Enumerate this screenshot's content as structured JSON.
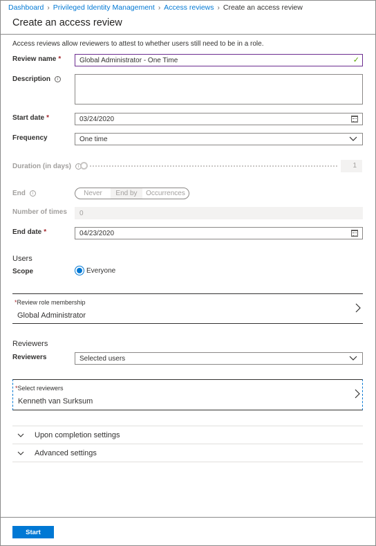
{
  "breadcrumb": {
    "items": [
      "Dashboard",
      "Privileged Identity Management",
      "Access reviews"
    ],
    "current": "Create an access review"
  },
  "page_title": "Create an access review",
  "intro": "Access reviews allow reviewers to attest to whether users still need to be in a role.",
  "form": {
    "review_name": {
      "label": "Review name",
      "value": "Global Administrator - One Time"
    },
    "description": {
      "label": "Description",
      "value": ""
    },
    "start_date": {
      "label": "Start date",
      "value": "03/24/2020"
    },
    "frequency": {
      "label": "Frequency",
      "value": "One time"
    },
    "duration": {
      "label": "Duration (in days)",
      "value": "1"
    },
    "end": {
      "label": "End",
      "options": [
        "Never",
        "End by",
        "Occurrences"
      ],
      "selected": "End by"
    },
    "number_of_times": {
      "label": "Number of times",
      "value": "0"
    },
    "end_date": {
      "label": "End date",
      "value": "04/23/2020"
    }
  },
  "users": {
    "heading": "Users",
    "scope_label": "Scope",
    "scope_value": "Everyone",
    "role_membership": {
      "label": "Review role membership",
      "value": "Global Administrator"
    }
  },
  "reviewers": {
    "heading": "Reviewers",
    "label": "Reviewers",
    "value": "Selected users",
    "select": {
      "label": "Select reviewers",
      "value": "Kenneth van Surksum"
    }
  },
  "expanders": [
    "Upon completion settings",
    "Advanced settings"
  ],
  "start_button": "Start",
  "required_mark": "*",
  "info_glyph": "i",
  "colors": {
    "accent": "#0078d4",
    "required": "#a4262c",
    "valid": "#57a300",
    "active_border": "#6b2c8f"
  }
}
